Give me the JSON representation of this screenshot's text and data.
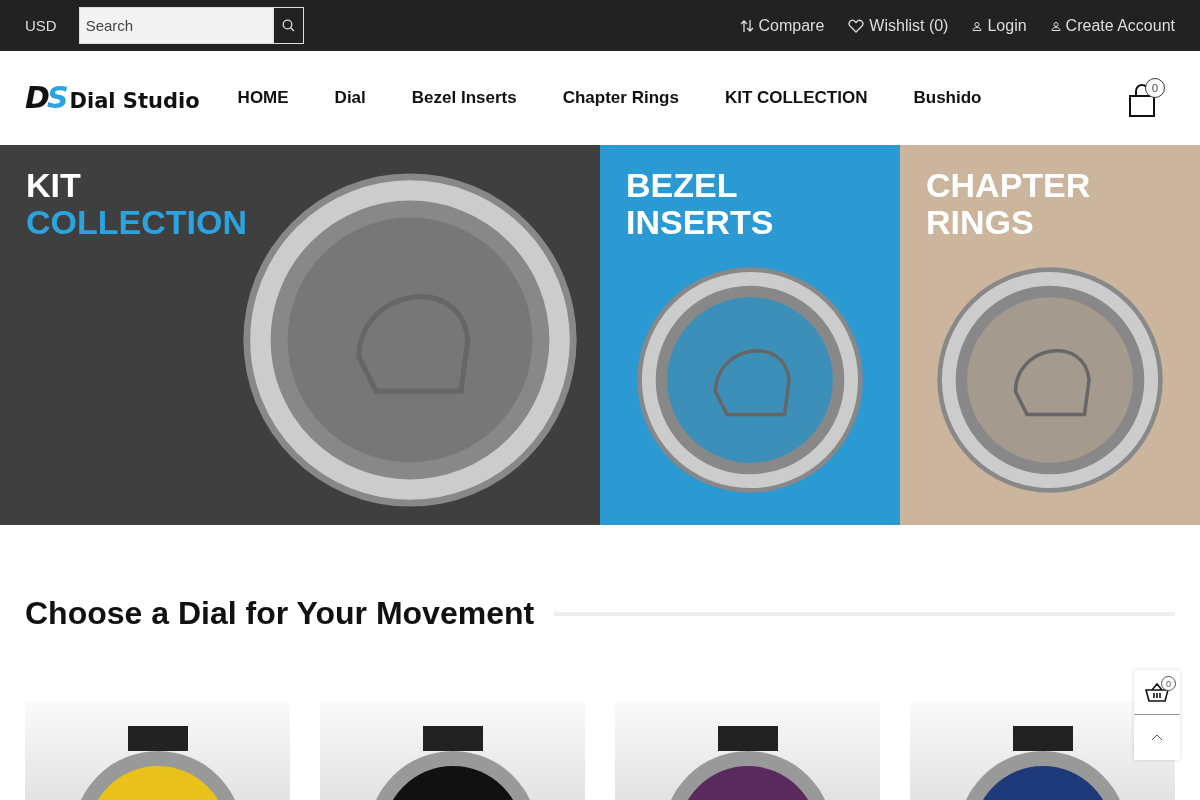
{
  "topbar": {
    "currency": "USD",
    "search": {
      "placeholder": "Search"
    },
    "links": [
      {
        "kind": "compare",
        "label": "Compare"
      },
      {
        "kind": "wishlist",
        "label": "Wishlist (0)"
      },
      {
        "kind": "user",
        "label": "Login"
      },
      {
        "kind": "user",
        "label": "Create Account"
      }
    ]
  },
  "header": {
    "logo": {
      "mark_1": "D",
      "mark_2": "S",
      "name": "Dial Studio"
    },
    "nav": [
      {
        "label": "HOME"
      },
      {
        "label": "Dial"
      },
      {
        "label": "Bezel Inserts"
      },
      {
        "label": "Chapter Rings"
      },
      {
        "label": "KIT COLLECTION"
      },
      {
        "label": "Bushido"
      }
    ],
    "cart_count": "0"
  },
  "banners": [
    {
      "line_1": "KIT",
      "line_2": "COLLECTION",
      "color": "#3f3f3f"
    },
    {
      "line_1": "BEZEL",
      "line_2": "INSERTS",
      "color": "#2b9ad2"
    },
    {
      "line_1": "CHAPTER",
      "line_2": "RINGS",
      "color": "#cbb59d"
    }
  ],
  "section": {
    "title": "Choose a Dial for Your Movement"
  },
  "products": [
    {
      "color": "#e8c21a"
    },
    {
      "color": "#111111"
    },
    {
      "color": "#5a2a5e"
    },
    {
      "color": "#1f3a7a"
    }
  ],
  "floating": {
    "basket_count": "0"
  }
}
